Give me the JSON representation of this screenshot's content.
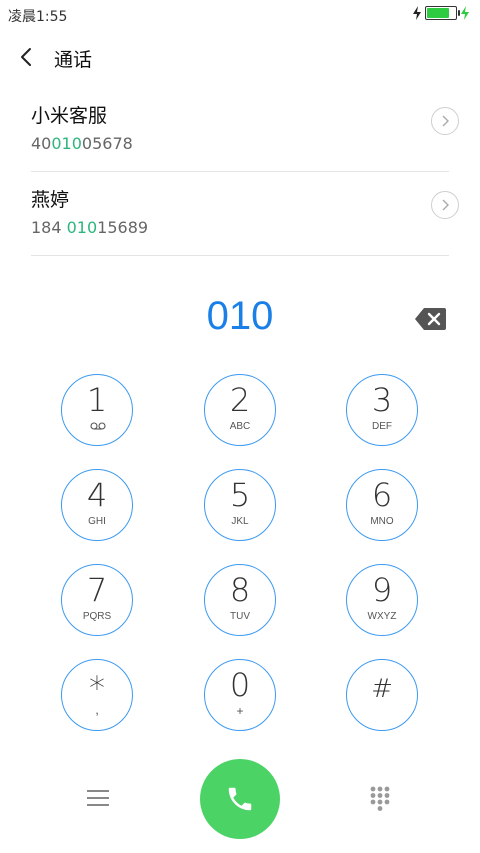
{
  "status_bar": {
    "time": "凌晨1:55",
    "battery_level": 0.85
  },
  "header": {
    "title": "通话"
  },
  "contacts": [
    {
      "name": "小米客服",
      "number_prefix": "40",
      "number_match": "010",
      "number_suffix": "05678"
    },
    {
      "name": "燕婷",
      "number_prefix": "184 ",
      "number_match": "010",
      "number_suffix": "15689"
    }
  ],
  "dial": {
    "input": "010"
  },
  "keypad": [
    {
      "digit": "1",
      "sub": "voicemail-icon"
    },
    {
      "digit": "2",
      "sub": "ABC"
    },
    {
      "digit": "3",
      "sub": "DEF"
    },
    {
      "digit": "4",
      "sub": "GHI"
    },
    {
      "digit": "5",
      "sub": "JKL"
    },
    {
      "digit": "6",
      "sub": "MNO"
    },
    {
      "digit": "7",
      "sub": "PQRS"
    },
    {
      "digit": "8",
      "sub": "TUV"
    },
    {
      "digit": "9",
      "sub": "WXYZ"
    },
    {
      "digit": "*",
      "sub": ","
    },
    {
      "digit": "0",
      "sub": "+"
    },
    {
      "digit": "#",
      "sub": ""
    }
  ],
  "icons": {
    "back": "back-arrow-icon",
    "detail": "chevron-right-icon",
    "backspace": "backspace-icon",
    "menu": "menu-icon",
    "call": "phone-icon",
    "dialpad": "dialpad-icon"
  },
  "colors": {
    "accent": "#1a80e8",
    "key_border": "#3d9af0",
    "match": "#2db67c",
    "call": "#4cd366"
  }
}
